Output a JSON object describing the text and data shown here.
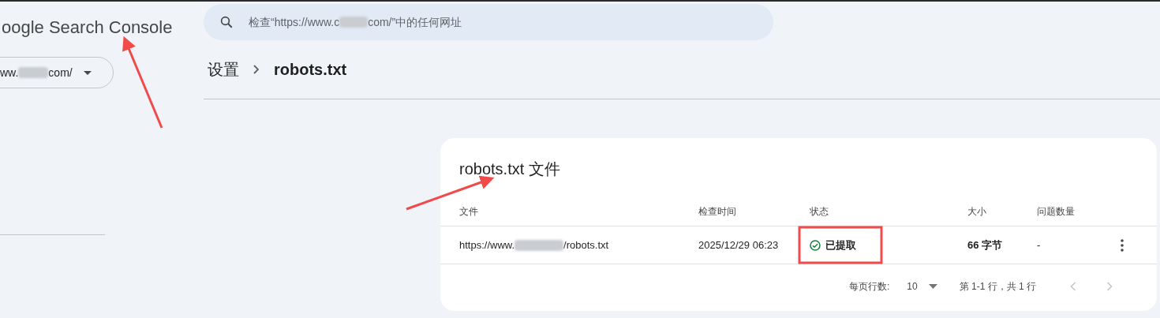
{
  "app": {
    "logo": "oogle Search Console"
  },
  "property": {
    "text_before": "ww.",
    "text_after": "com/"
  },
  "search": {
    "placeholder_before": "检查“https://www.c",
    "placeholder_after": "com/”中的任何网址"
  },
  "breadcrumb": [
    "设置",
    "robots.txt"
  ],
  "card": {
    "title": "robots.txt 文件",
    "columns": [
      "文件",
      "检查时间",
      "状态",
      "大小",
      "问题数量"
    ],
    "rows": [
      {
        "file_before": "https://www.",
        "file_after": "/robots.txt",
        "checked": "2025/12/29 06:23",
        "status": "已提取",
        "status_ok": true,
        "size": "66 字节",
        "issues": "-"
      }
    ],
    "footer": {
      "rows_per_page_label": "每页行数:",
      "rows_per_page": "10",
      "range": "第 1-1 行，共 1 行",
      "prev_disabled": true,
      "next_disabled": true
    }
  },
  "annotations": [
    {
      "kind": "arrow"
    },
    {
      "kind": "arrow"
    },
    {
      "kind": "highlight"
    }
  ]
}
